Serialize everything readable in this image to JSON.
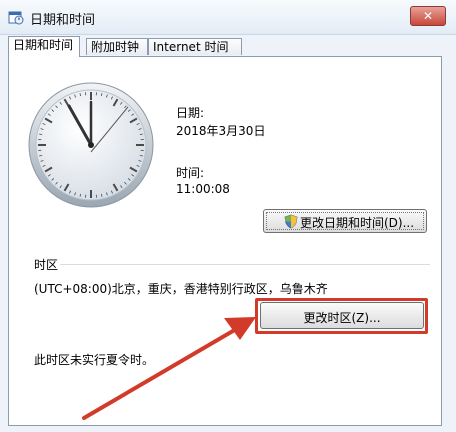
{
  "window": {
    "title": "日期和时间",
    "close_label": "✕"
  },
  "tabs": [
    {
      "label": "日期和时间"
    },
    {
      "label": "附加时钟"
    },
    {
      "label": "Internet 时间"
    }
  ],
  "date_section": {
    "date_label": "日期:",
    "date_value": "2018年3月30日",
    "time_label": "时间:",
    "time_value": "11:00:08",
    "change_datetime_button": "更改日期和时间(D)..."
  },
  "timezone_section": {
    "heading": "时区",
    "timezone_value": "(UTC+08:00)北京，重庆，香港特别行政区，乌鲁木齐",
    "change_timezone_button": "更改时区(Z)...",
    "dst_note": "此时区未实行夏令时。"
  },
  "colors": {
    "highlight": "#d23a2a",
    "arrow": "#d23a2a"
  },
  "icons": [
    "calendar-clock-icon",
    "close-icon",
    "shield-icon",
    "analog-clock-icon"
  ]
}
